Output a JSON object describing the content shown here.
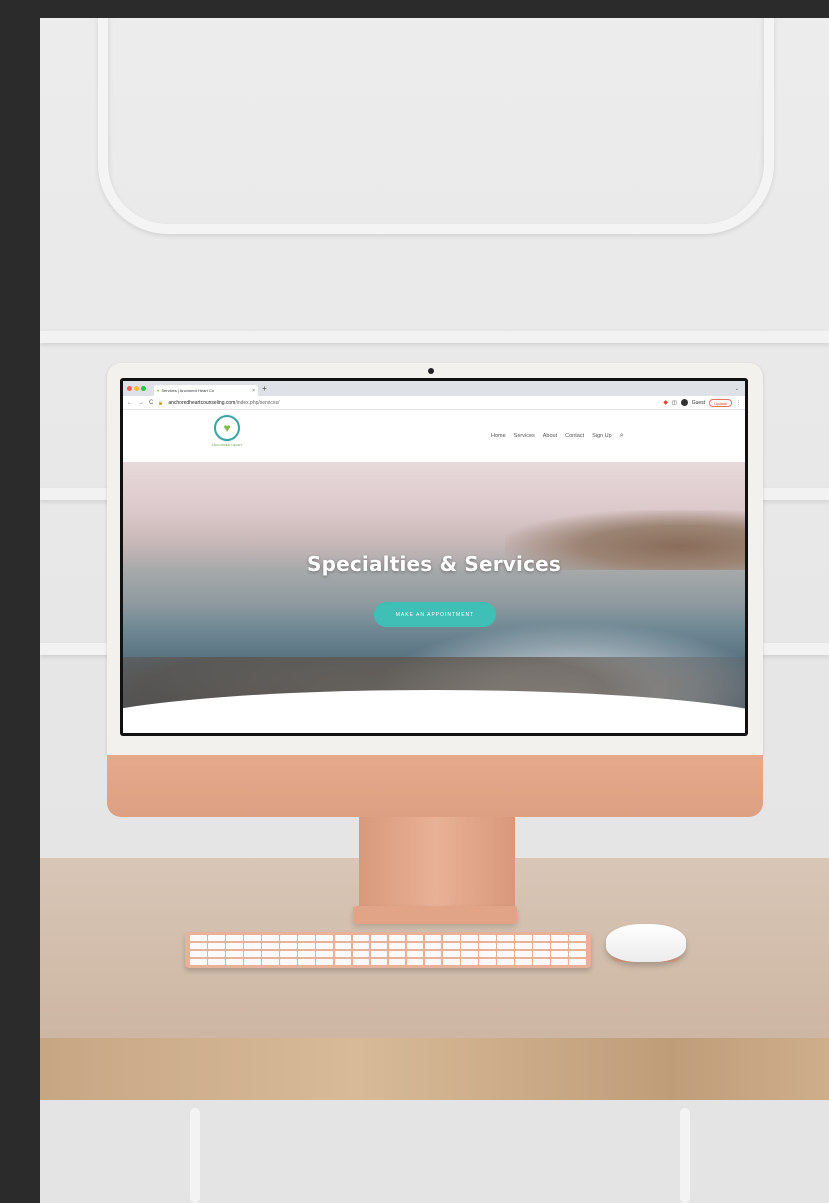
{
  "browser": {
    "tab_title": "Services | Anchored Heart Co",
    "tab_close": "×",
    "new_tab": "+",
    "tab_menu": "⌄",
    "nav_back": "←",
    "nav_forward": "→",
    "nav_reload": "C",
    "lock": "🔒",
    "url_domain": "anchoredheartcounseling.com",
    "url_path": "/index.php/services/",
    "guest_label": "Guest",
    "update_label": "Update",
    "colors": {
      "traffic_red": "#ff5f57",
      "traffic_yellow": "#febc2e",
      "traffic_green": "#28c840"
    }
  },
  "site": {
    "logo_text": "ANCHORED HEART",
    "nav": [
      "Home",
      "Services",
      "About",
      "Contact",
      "Sign Up"
    ],
    "search_icon": "⌕",
    "hero_title": "Specialties & Services",
    "hero_button": "MAKE AN APPOINTMENT",
    "accent_color": "#3fbfb5"
  }
}
